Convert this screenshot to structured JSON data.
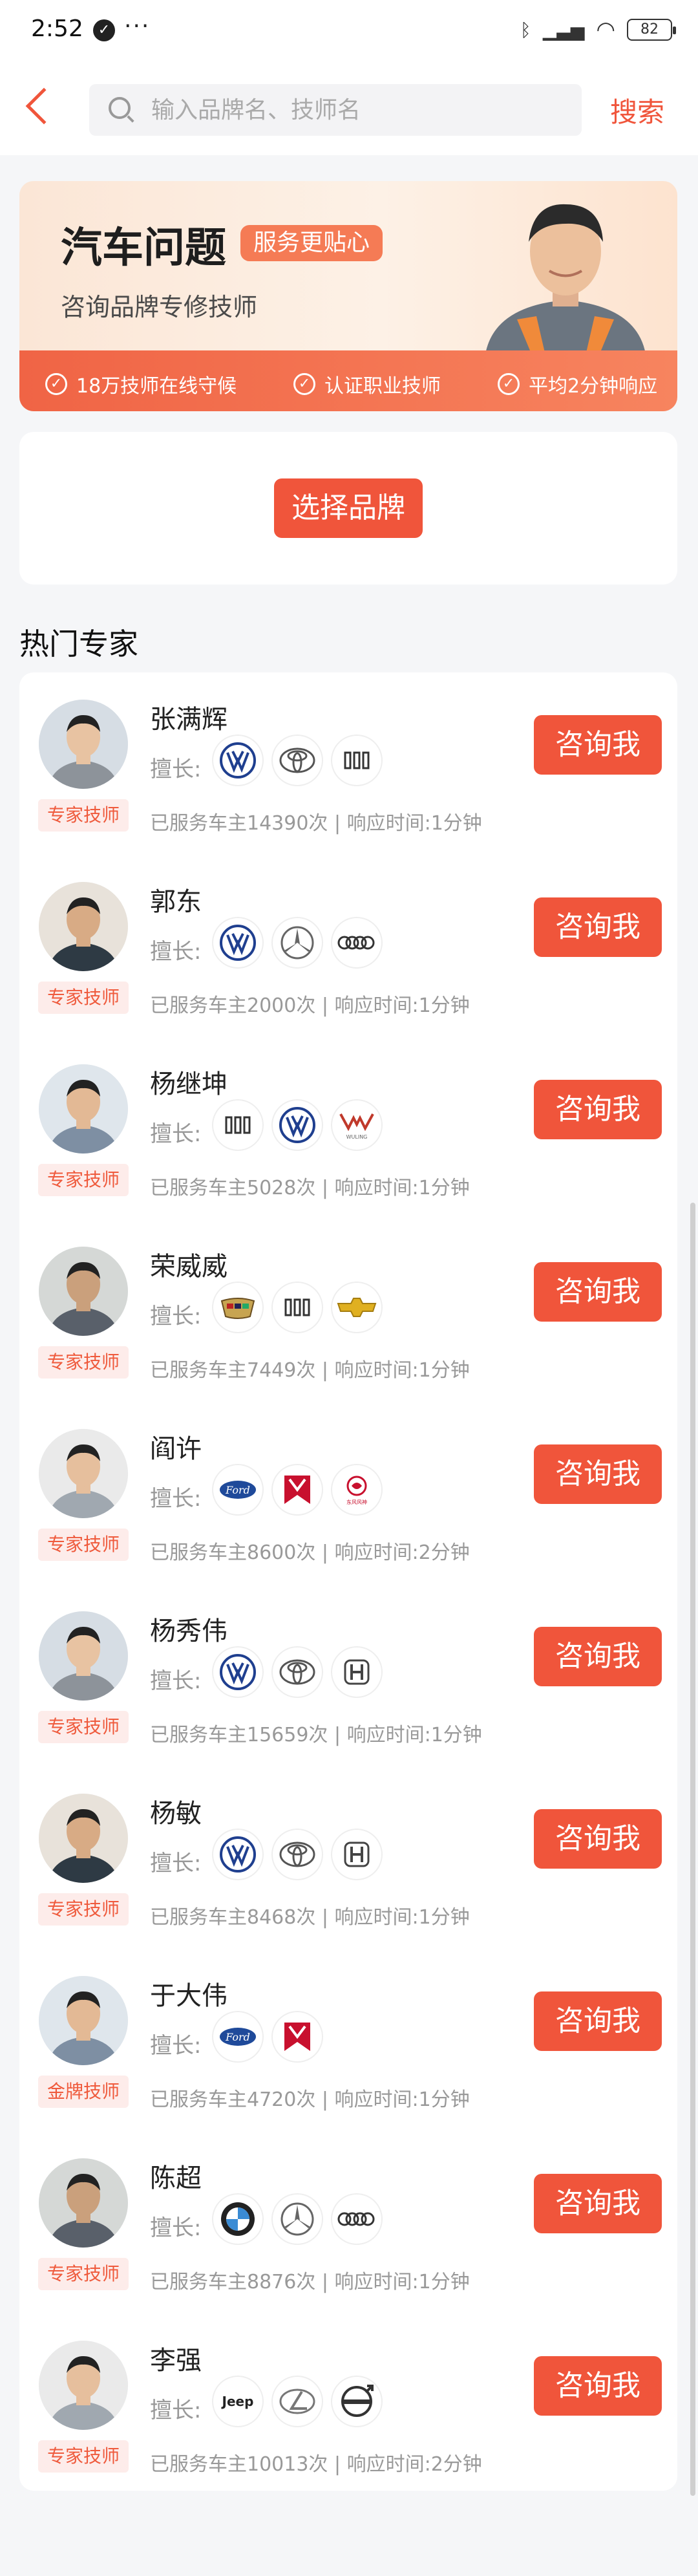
{
  "status": {
    "time": "2:52",
    "battery": "82"
  },
  "header": {
    "placeholder": "输入品牌名、技师名",
    "search_label": "搜索"
  },
  "banner": {
    "title": "汽车问题",
    "tag": "服务更贴心",
    "subtitle": "咨询品牌专修技师",
    "features": [
      "18万技师在线守候",
      "认证职业技师",
      "平均2分钟响应"
    ]
  },
  "brand_button": "选择品牌",
  "section_title": "热门专家",
  "skill_label": "擅长:",
  "consult_label": "咨询我",
  "experts": [
    {
      "name": "张满辉",
      "badge": "专家技师",
      "meta": "已服务车主14390次 | 响应时间:1分钟",
      "brands": [
        "volkswagen",
        "toyota",
        "great-wall"
      ]
    },
    {
      "name": "郭东",
      "badge": "专家技师",
      "meta": "已服务车主2000次 | 响应时间:1分钟",
      "brands": [
        "volkswagen",
        "mercedes",
        "audi"
      ]
    },
    {
      "name": "杨继坤",
      "badge": "专家技师",
      "meta": "已服务车主5028次 | 响应时间:1分钟",
      "brands": [
        "great-wall",
        "volkswagen",
        "wuling"
      ]
    },
    {
      "name": "荣威威",
      "badge": "专家技师",
      "meta": "已服务车主7449次 | 响应时间:1分钟",
      "brands": [
        "cadillac",
        "great-wall",
        "chevrolet"
      ]
    },
    {
      "name": "阎许",
      "badge": "专家技师",
      "meta": "已服务车主8600次 | 响应时间:2分钟",
      "brands": [
        "ford",
        "red-flag",
        "dongfeng"
      ]
    },
    {
      "name": "杨秀伟",
      "badge": "专家技师",
      "meta": "已服务车主15659次 | 响应时间:1分钟",
      "brands": [
        "volkswagen",
        "toyota",
        "honda"
      ]
    },
    {
      "name": "杨敏",
      "badge": "专家技师",
      "meta": "已服务车主8468次 | 响应时间:1分钟",
      "brands": [
        "volkswagen",
        "toyota",
        "honda"
      ]
    },
    {
      "name": "于大伟",
      "badge": "金牌技师",
      "meta": "已服务车主4720次 | 响应时间:1分钟",
      "brands": [
        "ford",
        "red-flag"
      ]
    },
    {
      "name": "陈超",
      "badge": "专家技师",
      "meta": "已服务车主8876次 | 响应时间:1分钟",
      "brands": [
        "bmw",
        "mercedes",
        "audi"
      ]
    },
    {
      "name": "李强",
      "badge": "专家技师",
      "meta": "已服务车主10013次 | 响应时间:2分钟",
      "brands": [
        "jeep",
        "lexus",
        "volvo"
      ]
    }
  ],
  "colors": {
    "accent": "#f0553b",
    "badge_bg": "#fdecea"
  }
}
